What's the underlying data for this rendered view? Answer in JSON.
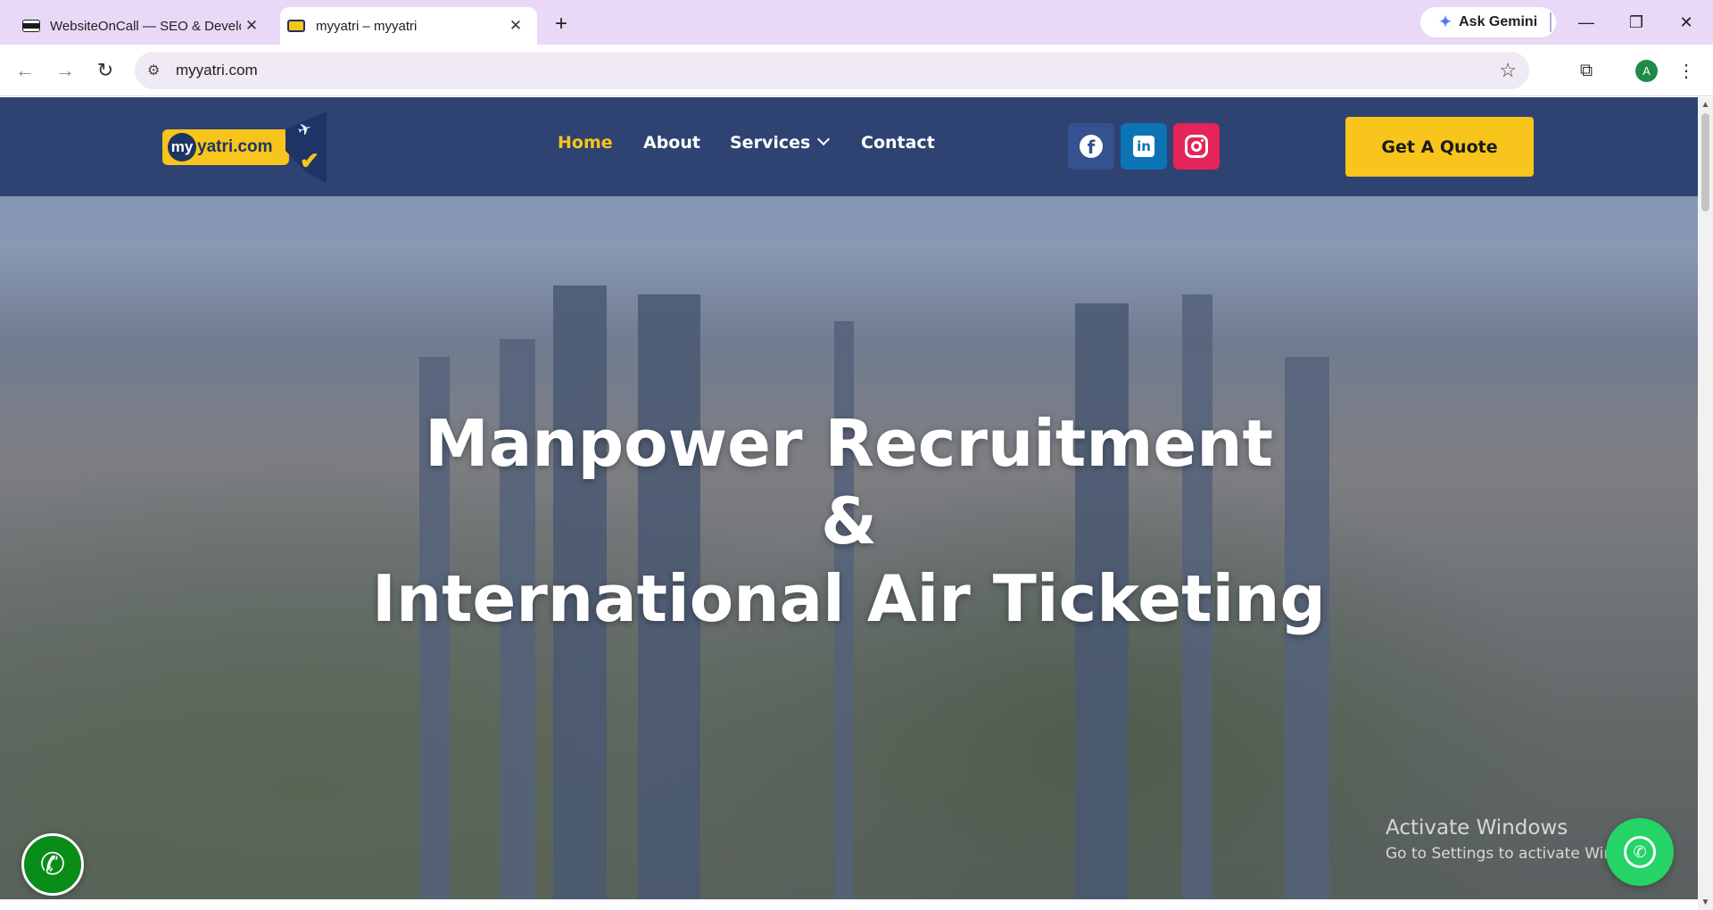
{
  "browser": {
    "tabs": [
      {
        "title": "WebsiteOnCall — SEO & Develo",
        "active": false
      },
      {
        "title": "myyatri – myyatri",
        "active": true
      }
    ],
    "new_tab_label": "+",
    "ask_gemini": "Ask Gemini",
    "url": "myyatri.com",
    "profile_initial": "A",
    "window_controls": {
      "minimize": "—",
      "restore": "❐",
      "close": "✕"
    }
  },
  "site": {
    "logo": {
      "prefix": "my",
      "rest": "yatri.com"
    },
    "nav": [
      {
        "label": "Home",
        "active": true
      },
      {
        "label": "About",
        "active": false
      },
      {
        "label": "Services",
        "active": false,
        "has_dropdown": true
      },
      {
        "label": "Contact",
        "active": false
      }
    ],
    "social": [
      {
        "name": "facebook",
        "icon": "facebook-icon",
        "color": "#33528f"
      },
      {
        "name": "linkedin",
        "icon": "linkedin-icon",
        "color": "#0b74b5"
      },
      {
        "name": "instagram",
        "icon": "instagram-icon",
        "color": "#e4245a"
      }
    ],
    "quote_button": "Get A Quote",
    "accent_color": "#f7c51b",
    "header_color": "#223868"
  },
  "hero": {
    "line1": "Manpower Recruitment",
    "line2": "&",
    "line3": "International Air Ticketing"
  },
  "watermark": {
    "title": "Activate Windows",
    "subtitle": "Go to Settings to activate Windows."
  },
  "floating": {
    "call_icon": "phone-icon",
    "whatsapp_icon": "whatsapp-icon"
  }
}
